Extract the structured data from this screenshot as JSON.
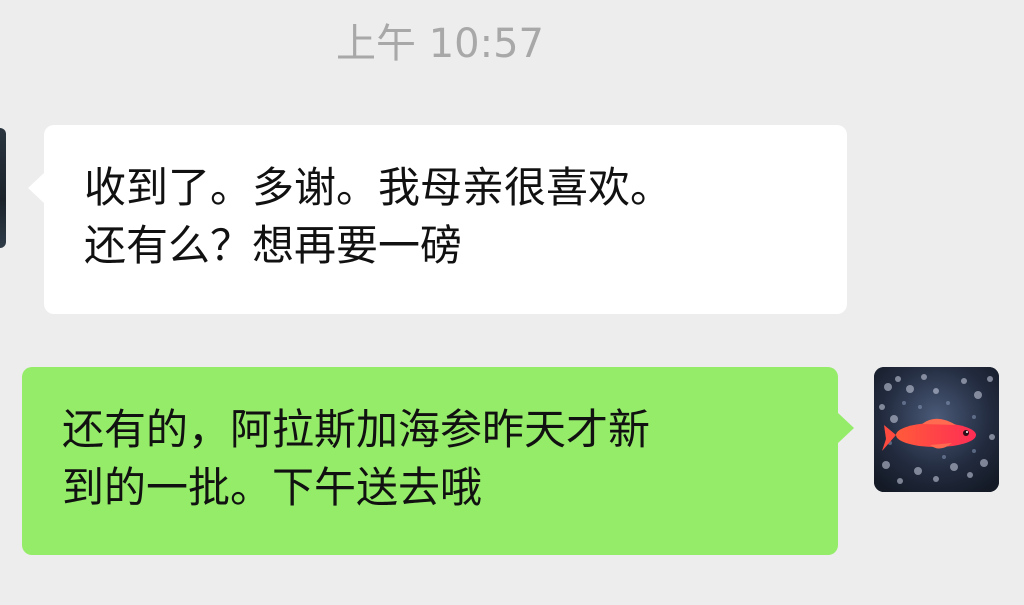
{
  "chat": {
    "timestamp": "上午 10:57",
    "messages": [
      {
        "direction": "incoming",
        "lines": [
          "收到了。多谢。我母亲很喜欢。",
          "还有么？想再要一磅"
        ]
      },
      {
        "direction": "outgoing",
        "lines": [
          "还有的，阿拉斯加海参昨天才新",
          "到的一批。下午送去哦"
        ]
      }
    ]
  },
  "colors": {
    "background": "#ededed",
    "incoming_bubble": "#ffffff",
    "outgoing_bubble": "#95ec69",
    "timestamp_text": "#a8a8a8"
  },
  "icons": {
    "left_avatar": "contact-avatar",
    "right_avatar": "fish-avatar"
  }
}
